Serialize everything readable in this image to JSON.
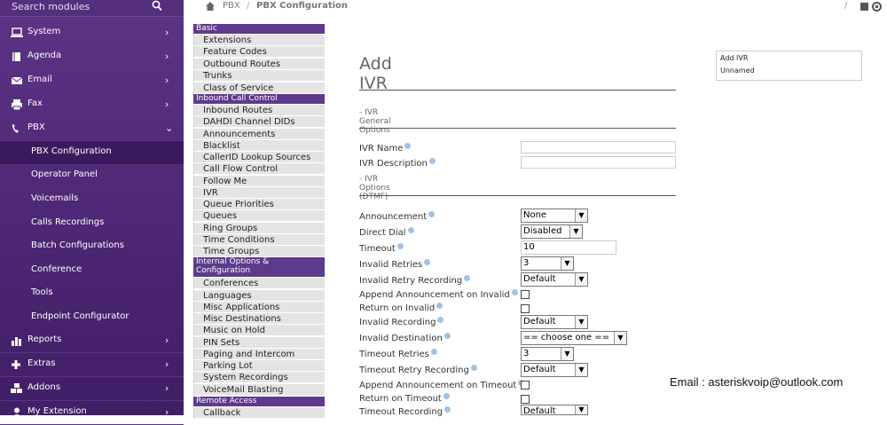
{
  "sidebar": {
    "search_label": "Search modules",
    "menu": [
      {
        "label": "System",
        "icon": "laptop-icon"
      },
      {
        "label": "Agenda",
        "icon": "book-icon"
      },
      {
        "label": "Email",
        "icon": "envelope-icon"
      },
      {
        "label": "Fax",
        "icon": "printer-icon"
      },
      {
        "label": "PBX",
        "icon": "phone-icon"
      },
      {
        "label": "Reports",
        "icon": "bar-chart-icon"
      },
      {
        "label": "Extras",
        "icon": "plus-icon"
      },
      {
        "label": "Addons",
        "icon": "cubes-icon"
      },
      {
        "label": "My Extension",
        "icon": "user-icon"
      }
    ],
    "pbx_submenu": [
      "PBX Configuration",
      "Operator Panel",
      "Voicemails",
      "Calls Recordings",
      "Batch Configurations",
      "Conference",
      "Tools",
      "Endpoint Configurator"
    ],
    "active_submenu": "PBX Configuration"
  },
  "breadcrumb": {
    "root": "PBX",
    "separator": "/",
    "current": "PBX Configuration",
    "right_separator": "/"
  },
  "subnav": {
    "groups": [
      {
        "title": "Basic",
        "items": [
          "Extensions",
          "Feature Codes",
          "Outbound Routes",
          "Trunks",
          "Class of Service"
        ]
      },
      {
        "title": "Inbound Call Control",
        "items": [
          "Inbound Routes",
          "DAHDI Channel DIDs",
          "Announcements",
          "Blacklist",
          "CallerID Lookup Sources",
          "Call Flow Control",
          "Follow Me",
          "IVR",
          "Queue Priorities",
          "Queues",
          "Ring Groups",
          "Time Conditions",
          "Time Groups"
        ]
      },
      {
        "title": "Internal Options & Configuration",
        "items": [
          "Conferences",
          "Languages",
          "Misc Applications",
          "Misc Destinations",
          "Music on Hold",
          "PIN Sets",
          "Paging and Intercom",
          "Parking Lot",
          "System Recordings",
          "VoiceMail Blasting"
        ]
      },
      {
        "title": "Remote Access",
        "items": [
          "Callback"
        ]
      }
    ]
  },
  "form": {
    "title": "Add IVR",
    "general_section": "- IVR General Options",
    "ivr_name_label": "IVR Name",
    "ivr_name_value": "",
    "ivr_description_label": "IVR Description",
    "ivr_description_value": "",
    "dtmf_section": "- IVR Options (DTMF)",
    "announcement_label": "Announcement",
    "announcement_value": "None",
    "direct_dial_label": "Direct Dial",
    "direct_dial_value": "Disabled",
    "timeout_label": "Timeout",
    "timeout_value": "10",
    "invalid_retries_label": "Invalid Retries",
    "invalid_retries_value": "3",
    "invalid_retry_recording_label": "Invalid Retry Recording",
    "invalid_retry_recording_value": "Default",
    "append_ann_invalid_label": "Append Announcement on Invalid",
    "return_on_invalid_label": "Return on Invalid",
    "invalid_recording_label": "Invalid Recording",
    "invalid_recording_value": "Default",
    "invalid_destination_label": "Invalid Destination",
    "invalid_destination_value": "== choose one ==",
    "timeout_retries_label": "Timeout Retries",
    "timeout_retries_value": "3",
    "timeout_retry_recording_label": "Timeout Retry Recording",
    "timeout_retry_recording_value": "Default",
    "append_ann_timeout_label": "Append Announcement on Timeout",
    "return_on_timeout_label": "Return on Timeout",
    "timeout_recording_label": "Timeout Recording",
    "timeout_recording_value": "Default"
  },
  "right_panel": {
    "items": [
      "Add IVR",
      "Unnamed"
    ]
  },
  "contact": "Email : asteriskvoip@outlook.com",
  "colors": {
    "sidebar": "#4a2673",
    "subnav_header": "#5e3a8c",
    "help_icon": "#9ec3e6"
  }
}
